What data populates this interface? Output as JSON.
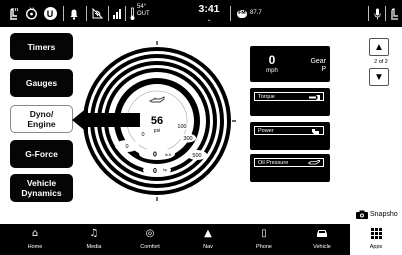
{
  "status_bar": {
    "icons": [
      "seat-heat-icon",
      "steering-heat-icon",
      "uconnect-icon",
      "bell-icon",
      "wifi-icon",
      "signal-icon",
      "thermometer-icon",
      "mic-icon",
      "seat-icon"
    ],
    "outside_temp_value": "54°",
    "outside_temp_unit": "OUT",
    "time": "3:41",
    "radio_band_label": "FM",
    "radio_freq": "87.7"
  },
  "sidebar": {
    "items": [
      {
        "label": "Timers",
        "active": false
      },
      {
        "label": "Gauges",
        "active": false
      },
      {
        "label": "Dyno/\nEngine",
        "active": true
      },
      {
        "label": "G-Force",
        "active": false
      },
      {
        "label": "Vehicle\nDynamics",
        "active": false
      }
    ]
  },
  "gauge": {
    "center_value": "56",
    "center_unit": "psi",
    "inner_ring_min": "0",
    "inner_ring_max": "100",
    "ring2_max": "300",
    "ring3_max": "500",
    "lbft_min": "0",
    "lbft_value": "0",
    "lbft_unit": "lb-ft",
    "hp_value": "0",
    "hp_unit": "hp"
  },
  "right_panel": {
    "speed_value": "0",
    "speed_unit": "mph",
    "gear_label": "Gear",
    "gear_value": "P",
    "torque_label": "Torque",
    "power_label": "Power",
    "oil_label": "Oil Pressure"
  },
  "pager": {
    "text": "2 of 2"
  },
  "snapshot": {
    "label": "Snapsho"
  },
  "bottom_nav": [
    {
      "label": "Home",
      "icon": "home-icon",
      "glyph": "⌂"
    },
    {
      "label": "Media",
      "icon": "music-icon",
      "glyph": "♫"
    },
    {
      "label": "Comfort",
      "icon": "climate-icon",
      "glyph": "◎"
    },
    {
      "label": "Nav",
      "icon": "navigation-icon",
      "glyph": "▲"
    },
    {
      "label": "Phone",
      "icon": "phone-icon",
      "glyph": "▯"
    },
    {
      "label": "Vehicle",
      "icon": "car-icon",
      "glyph": "🚗"
    },
    {
      "label": "Apps",
      "icon": "apps-icon",
      "glyph": "⠿"
    }
  ],
  "colors": {
    "background": "#ffffff",
    "bars": "#000000",
    "active_tab": "#ffffff"
  }
}
